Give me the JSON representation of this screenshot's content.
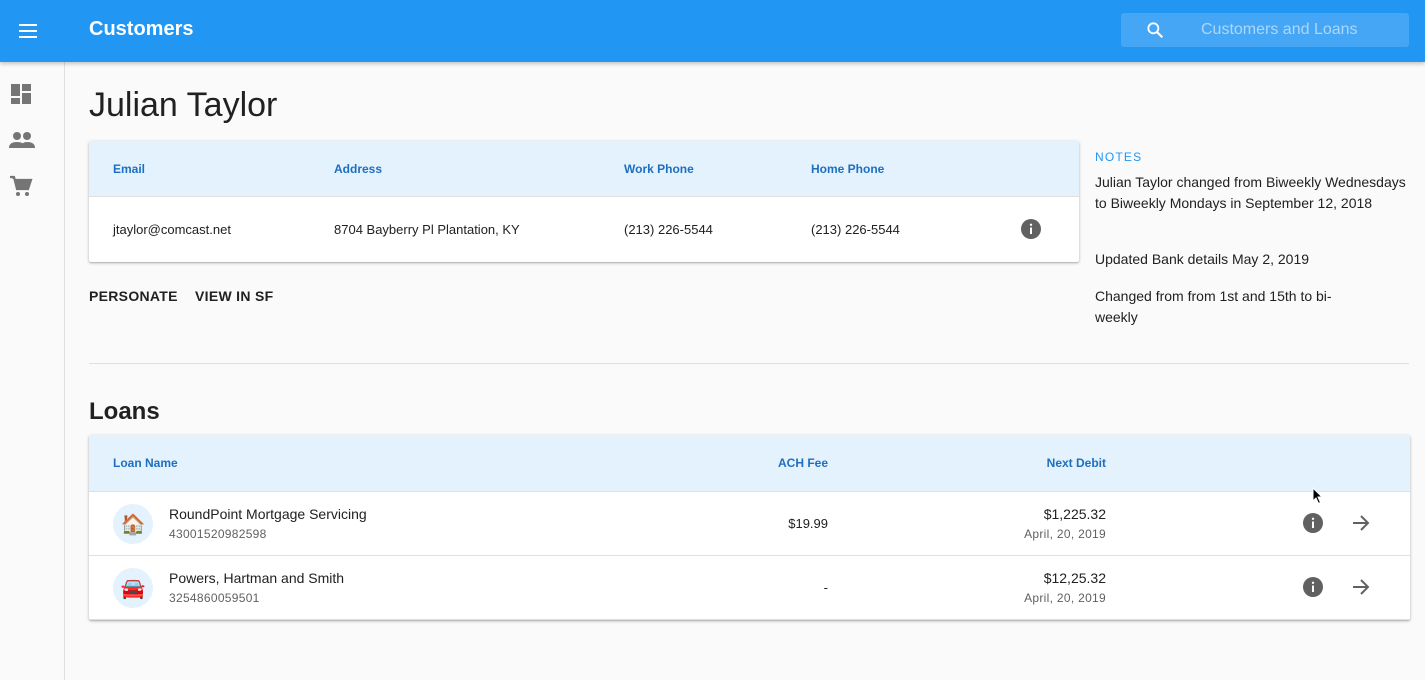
{
  "app": {
    "title": "Customers",
    "search_placeholder": "Customers and Loans",
    "brand_color": "#2196f3"
  },
  "sidebar": {
    "items": [
      {
        "icon": "dashboard-icon"
      },
      {
        "icon": "people-icon"
      },
      {
        "icon": "cart-icon"
      }
    ]
  },
  "customer": {
    "name": "Julian Taylor",
    "headers": {
      "email": "Email",
      "address": "Address",
      "work_phone": "Work Phone",
      "home_phone": "Home Phone"
    },
    "email": "jtaylor@comcast.net",
    "address": "8704 Bayberry Pl Plantation, KY",
    "work_phone": "(213) 226-5544",
    "home_phone": "(213) 226-5544"
  },
  "actions": {
    "personate": "PERSONATE",
    "view_in_sf": "VIEW IN SF"
  },
  "notes": {
    "label": "NOTES",
    "items": [
      "Julian Taylor changed from Biweekly Wednesdays to Biweekly Mondays in September 12, 2018",
      "Updated Bank details May 2, 2019",
      "Changed from from 1st and 15th to bi-weekly"
    ]
  },
  "loans": {
    "title": "Loans",
    "headers": {
      "name": "Loan Name",
      "ach_fee": "ACH Fee",
      "next_debit": "Next Debit"
    },
    "rows": [
      {
        "icon": "house-icon",
        "name": "RoundPoint Mortgage Servicing",
        "account": "43001520982598",
        "ach_fee": "$19.99",
        "amount": "$1,225.32",
        "date": "April, 20, 2019"
      },
      {
        "icon": "car-icon",
        "name": "Powers, Hartman and Smith",
        "account": "3254860059501",
        "ach_fee": "-",
        "amount": "$12,25.32",
        "date": "April, 20, 2019"
      }
    ]
  }
}
